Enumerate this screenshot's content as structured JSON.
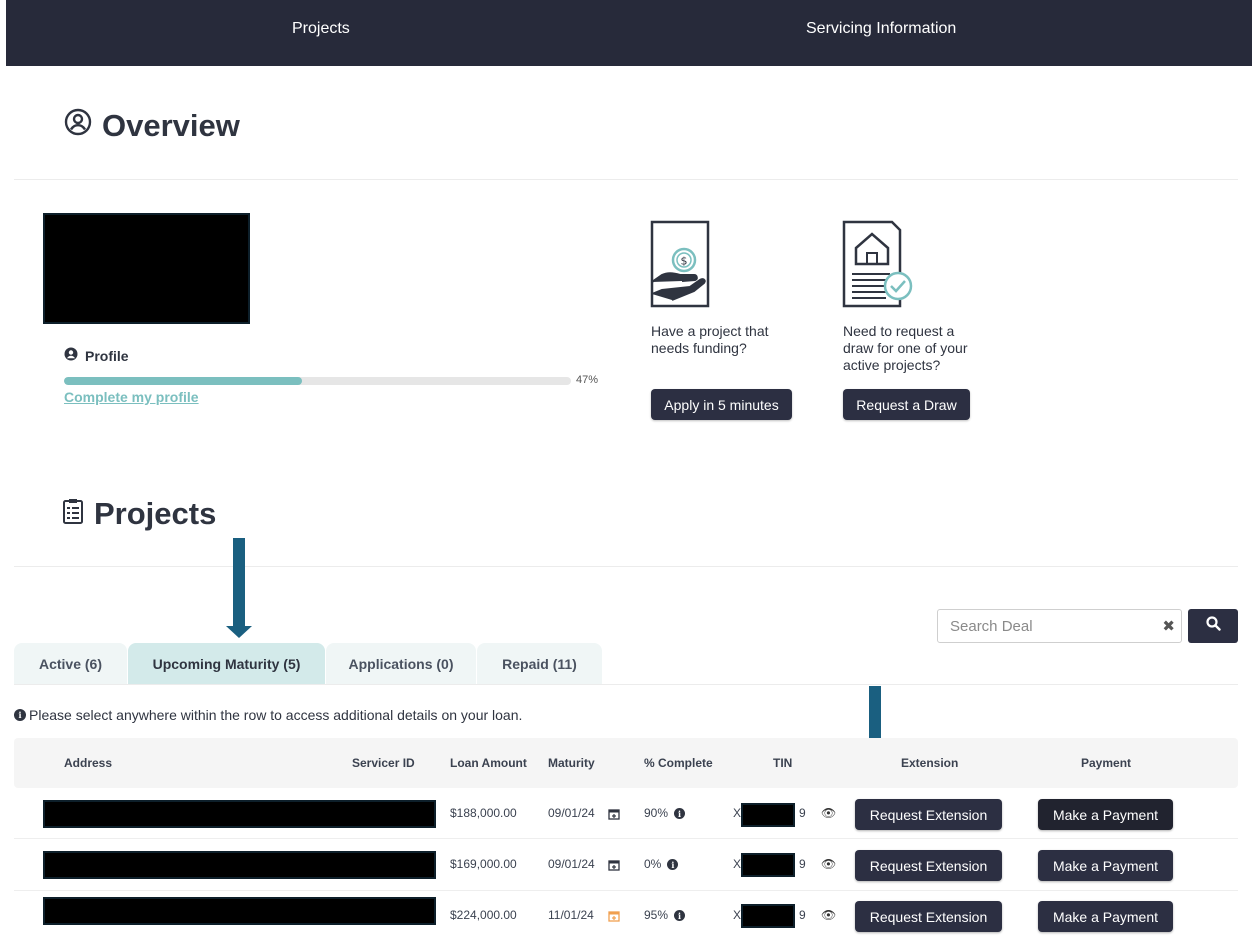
{
  "nav": {
    "projects": "Projects",
    "servicing": "Servicing Information"
  },
  "overview": {
    "title": "Overview"
  },
  "profile": {
    "label": "Profile",
    "progress_percent": 47,
    "progress_text": "47%",
    "complete_link": "Complete my profile"
  },
  "cards": [
    {
      "text": "Have a project that needs funding?",
      "button": "Apply in 5 minutes",
      "icon": "hand-dollar-icon"
    },
    {
      "text": "Need to request a draw for one of your active projects?",
      "button": "Request a Draw",
      "icon": "house-document-icon"
    }
  ],
  "projects": {
    "title": "Projects"
  },
  "search": {
    "placeholder": "Search Deal"
  },
  "tabs": [
    {
      "label": "Active (6)",
      "active": false
    },
    {
      "label": "Upcoming Maturity (5)",
      "active": true
    },
    {
      "label": "Applications (0)",
      "active": false
    },
    {
      "label": "Repaid (11)",
      "active": false
    }
  ],
  "note": "Please select anywhere within the row to access additional details on your loan.",
  "table": {
    "headers": {
      "address": "Address",
      "servicer_id": "Servicer ID",
      "loan_amount": "Loan Amount",
      "maturity": "Maturity",
      "complete": "% Complete",
      "tin": "TIN",
      "extension": "Extension",
      "payment": "Payment"
    },
    "rows": [
      {
        "loan_amount": "$188,000.00",
        "maturity": "09/01/24",
        "complete": "90%",
        "tin_prefix": "X",
        "tin_suffix": "9",
        "extension": "Request Extension",
        "payment": "Make a Payment"
      },
      {
        "loan_amount": "$169,000.00",
        "maturity": "09/01/24",
        "complete": "0%",
        "tin_prefix": "X",
        "tin_suffix": "9",
        "extension": "Request Extension",
        "payment": "Make a Payment"
      },
      {
        "loan_amount": "$224,000.00",
        "maturity": "11/01/24",
        "complete": "95%",
        "tin_prefix": "X",
        "tin_suffix": "9",
        "extension": "Request Extension",
        "payment": "Make a Payment"
      }
    ]
  },
  "colors": {
    "nav_bg": "#272a3a",
    "accent_teal": "#7bbfbf",
    "button_dark": "#2c2f42",
    "arrow": "#1a5f80",
    "calendar_warn": "#f0a050"
  }
}
